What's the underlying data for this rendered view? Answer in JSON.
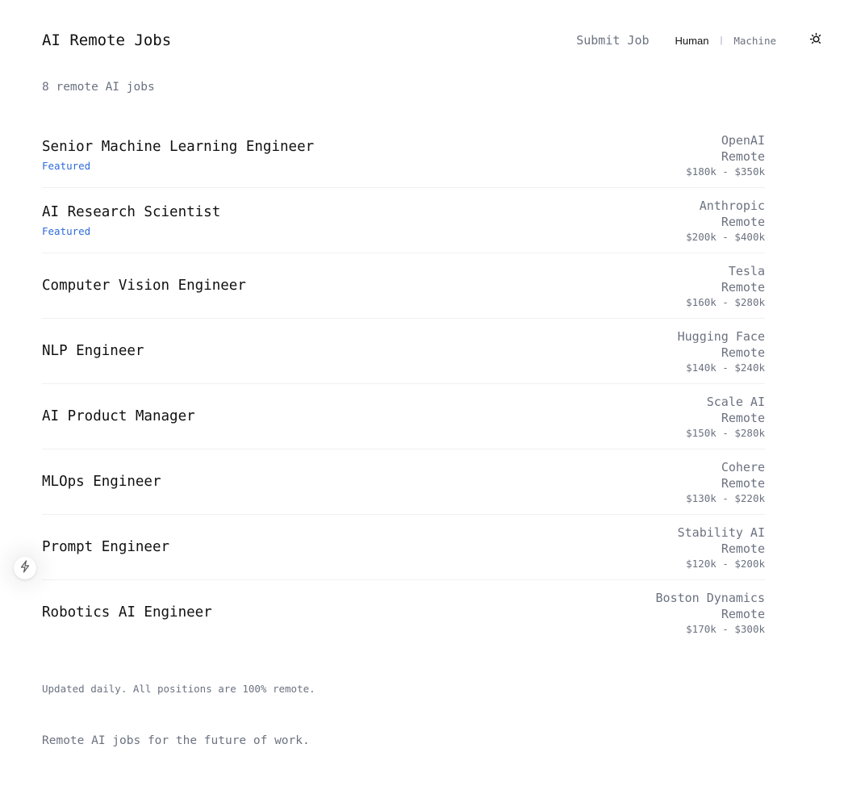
{
  "header": {
    "title": "AI Remote Jobs",
    "submit_label": "Submit Job",
    "mode": {
      "human_label": "Human",
      "separator": "|",
      "machine_label": "Machine",
      "selected": "Human"
    },
    "theme_icon": "sun-icon"
  },
  "job_count_text": "8 remote AI jobs",
  "jobs": [
    {
      "title": "Senior Machine Learning Engineer",
      "featured": "Featured",
      "company": "OpenAI",
      "location": "Remote",
      "salary": "$180k - $350k"
    },
    {
      "title": "AI Research Scientist",
      "featured": "Featured",
      "company": "Anthropic",
      "location": "Remote",
      "salary": "$200k - $400k"
    },
    {
      "title": "Computer Vision Engineer",
      "featured": "",
      "company": "Tesla",
      "location": "Remote",
      "salary": "$160k - $280k"
    },
    {
      "title": "NLP Engineer",
      "featured": "",
      "company": "Hugging Face",
      "location": "Remote",
      "salary": "$140k - $240k"
    },
    {
      "title": "AI Product Manager",
      "featured": "",
      "company": "Scale AI",
      "location": "Remote",
      "salary": "$150k - $280k"
    },
    {
      "title": "MLOps Engineer",
      "featured": "",
      "company": "Cohere",
      "location": "Remote",
      "salary": "$130k - $220k"
    },
    {
      "title": "Prompt Engineer",
      "featured": "",
      "company": "Stability AI",
      "location": "Remote",
      "salary": "$120k - $200k"
    },
    {
      "title": "Robotics AI Engineer",
      "featured": "",
      "company": "Boston Dynamics",
      "location": "Remote",
      "salary": "$170k - $300k"
    }
  ],
  "footer_note": "Updated daily. All positions are 100% remote.",
  "tagline": "Remote AI jobs for the future of work.",
  "floating_button_icon": "lightning-icon",
  "colors": {
    "text": "#111111",
    "muted": "#6b7280",
    "featured": "#2f6bd8",
    "divider": "#f0f0f2",
    "background": "#ffffff"
  }
}
